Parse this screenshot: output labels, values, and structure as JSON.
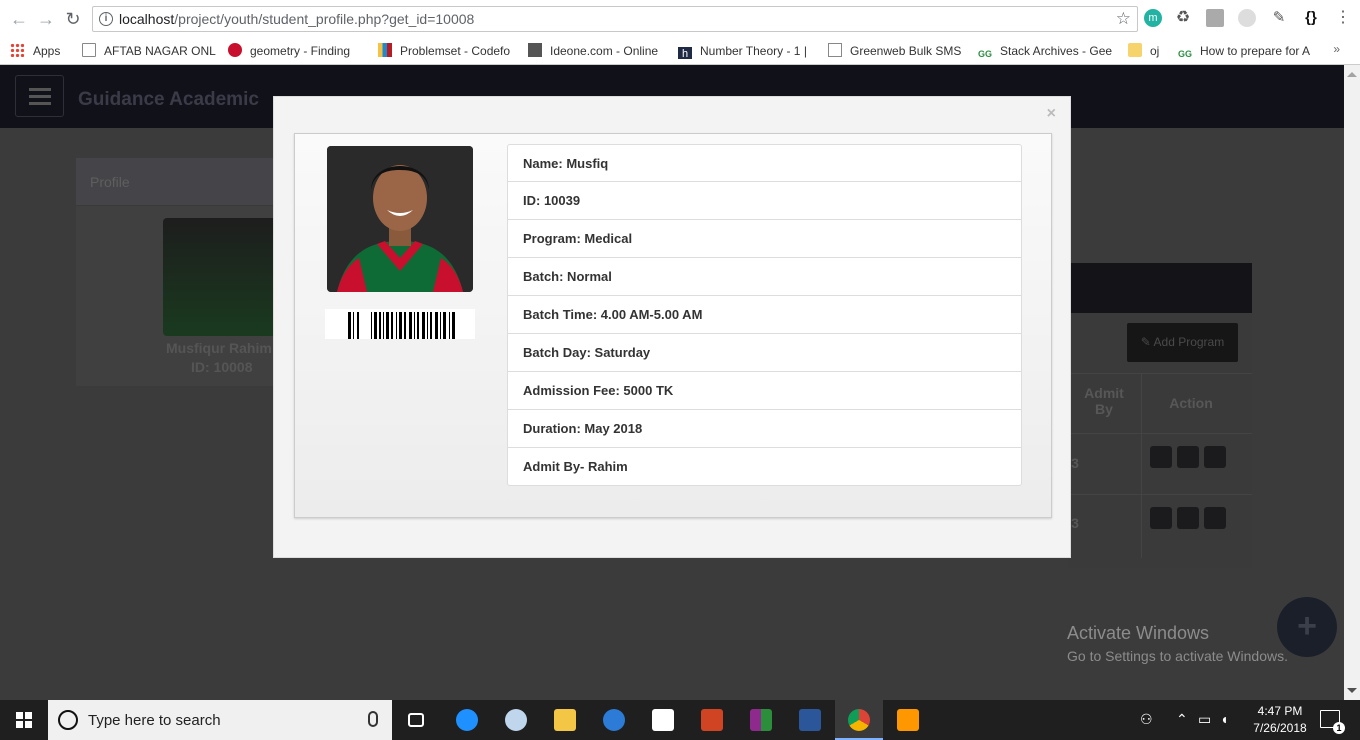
{
  "browser": {
    "url_host": "localhost",
    "url_path": "/project/youth/student_profile.php?get_id=10008",
    "bookmarks": [
      {
        "label": "Apps"
      },
      {
        "label": "AFTAB NAGAR ONLI"
      },
      {
        "label": "geometry - Finding"
      },
      {
        "label": "Problemset - Codefo"
      },
      {
        "label": "Ideone.com - Online"
      },
      {
        "label": "Number Theory - 1 |"
      },
      {
        "label": "Greenweb Bulk SMS"
      },
      {
        "label": "Stack Archives - Gee"
      },
      {
        "label": "oj"
      },
      {
        "label": "How to prepare for A"
      }
    ],
    "bookmarks_more": "»"
  },
  "app": {
    "brand": "Guidance Academic",
    "profile_header": "Profile",
    "profile_name": "Musfiqur Rahim",
    "profile_id": "ID: 10008",
    "add_program_label": "Add Program",
    "col_admit_by": "Admit By",
    "col_action": "Action",
    "row_cell": "3"
  },
  "modal": {
    "close": "×",
    "details": [
      "Name: Musfiq",
      "ID: 10039",
      "Program: Medical",
      "Batch: Normal",
      "Batch Time: 4.00 AM-5.00 AM",
      "Batch Day: Saturday",
      "Admission Fee: 5000 TK",
      "Duration: May 2018",
      "Admit By- Rahim"
    ]
  },
  "watermark": {
    "title": "Activate Windows",
    "subtitle": "Go to Settings to activate Windows."
  },
  "taskbar": {
    "search_placeholder": "Type here to search",
    "time": "4:47 PM",
    "date": "7/26/2018",
    "notification_count": "1"
  },
  "colors": {
    "modal_bg": "#f3f3f3",
    "header_dark": "#111119",
    "taskbar": "#1f1f1f"
  }
}
